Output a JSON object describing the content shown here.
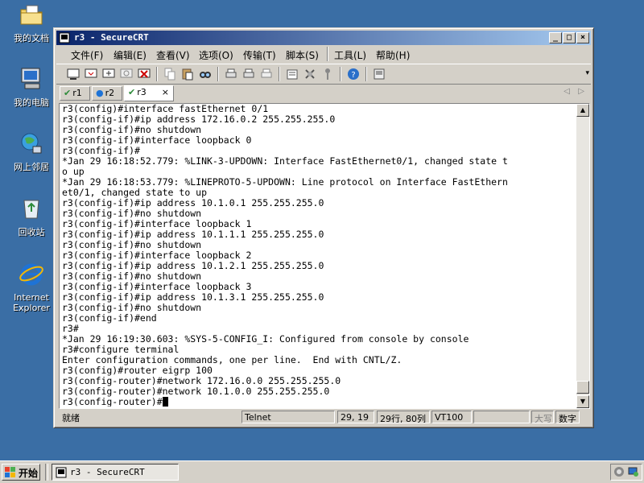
{
  "desktop": {
    "icons": [
      {
        "label": "我的文档"
      },
      {
        "label": "我的电脑"
      },
      {
        "label": "网上邻居"
      },
      {
        "label": "回收站"
      },
      {
        "label": "Internet Explorer"
      }
    ]
  },
  "window": {
    "title": "r3 - SecureCRT",
    "controls": {
      "minimize": "_",
      "maximize": "□",
      "close": "×"
    }
  },
  "menu": [
    "文件(F)",
    "编辑(E)",
    "查看(V)",
    "选项(O)",
    "传输(T)",
    "脚本(S)",
    "工具(L)",
    "帮助(H)"
  ],
  "tabs": [
    {
      "label": "r1",
      "status": "connected"
    },
    {
      "label": "r2",
      "status": "info"
    },
    {
      "label": "r3",
      "status": "connected",
      "active": true,
      "close": "×"
    }
  ],
  "terminal": {
    "lines": [
      "r3(config)#interface fastEthernet 0/1",
      "r3(config-if)#ip address 172.16.0.2 255.255.255.0",
      "r3(config-if)#no shutdown",
      "r3(config-if)#interface loopback 0",
      "r3(config-if)#",
      "*Jan 29 16:18:52.779: %LINK-3-UPDOWN: Interface FastEthernet0/1, changed state t",
      "o up",
      "*Jan 29 16:18:53.779: %LINEPROTO-5-UPDOWN: Line protocol on Interface FastEthern",
      "et0/1, changed state to up",
      "r3(config-if)#ip address 10.1.0.1 255.255.255.0",
      "r3(config-if)#no shutdown",
      "r3(config-if)#interface loopback 1",
      "r3(config-if)#ip address 10.1.1.1 255.255.255.0",
      "r3(config-if)#no shutdown",
      "r3(config-if)#interface loopback 2",
      "r3(config-if)#ip address 10.1.2.1 255.255.255.0",
      "r3(config-if)#no shutdown",
      "r3(config-if)#interface loopback 3",
      "r3(config-if)#ip address 10.1.3.1 255.255.255.0",
      "r3(config-if)#no shutdown",
      "r3(config-if)#end",
      "r3#",
      "*Jan 29 16:19:30.603: %SYS-5-CONFIG_I: Configured from console by console",
      "r3#configure terminal",
      "Enter configuration commands, one per line.  End with CNTL/Z.",
      "r3(config)#router eigrp 100",
      "r3(config-router)#network 172.16.0.0 255.255.255.0",
      "r3(config-router)#network 10.1.0.0 255.255.255.0"
    ],
    "prompt": "r3(config-router)#"
  },
  "status": {
    "ready": "就绪",
    "protocol": "Telnet",
    "position": "29, 19",
    "size": "29行, 80列",
    "emulation": "VT100",
    "caps": "大写",
    "num": "数字"
  },
  "taskbar": {
    "start": "开始",
    "task": "r3 - SecureCRT"
  },
  "colors": {
    "desktop": "#3a6ea5",
    "title_start": "#0a246a",
    "title_end": "#a6caf0",
    "chrome": "#d4d0c8"
  }
}
